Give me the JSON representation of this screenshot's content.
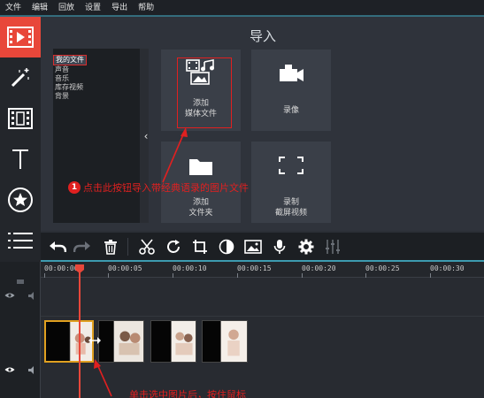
{
  "menu": {
    "items": [
      "文件",
      "编辑",
      "回放",
      "设置",
      "导出",
      "帮助"
    ]
  },
  "rail": {
    "buttons": [
      {
        "name": "import-icon",
        "active": true
      },
      {
        "name": "magic-wand-icon",
        "active": false
      },
      {
        "name": "film-icon",
        "active": false
      },
      {
        "name": "text-icon",
        "active": false
      },
      {
        "name": "sticker-icon",
        "active": false
      },
      {
        "name": "list-icon",
        "active": false
      }
    ]
  },
  "import": {
    "title": "导入",
    "folders": [
      "我的文件",
      "声音",
      "音乐",
      "库存视频",
      "背景"
    ],
    "selected_folder": "我的文件",
    "tiles": {
      "add_media": {
        "line1": "添加",
        "line2": "媒体文件",
        "icon": "add-media-icon"
      },
      "record": {
        "line1": "录像",
        "icon": "camera-icon"
      },
      "add_folder": {
        "line1": "添加",
        "line2": "文件夹",
        "icon": "folder-icon"
      },
      "screen_capture": {
        "line1": "录制",
        "line2": "截屏视频",
        "icon": "screen-capture-icon"
      }
    }
  },
  "annotations": {
    "step_number": "1",
    "step_text": "点击此按钮导入带经典语录的图片文件",
    "bottom_text": "单击选中图片后，按住鼠标"
  },
  "toolbar": {
    "icons": [
      "undo-icon",
      "redo-icon",
      "trash-icon",
      "scissors-icon",
      "rotate-icon",
      "crop-icon",
      "color-icon",
      "image-icon",
      "microphone-icon",
      "gear-icon",
      "equalizer-icon"
    ]
  },
  "timeline": {
    "ticks": [
      "00:00:00",
      "00:00:05",
      "00:00:10",
      "00:00:15",
      "00:00:20",
      "00:00:25",
      "00:00:30"
    ],
    "clips": [
      {
        "name": "clip-1",
        "selected": true
      },
      {
        "name": "clip-2",
        "selected": false
      },
      {
        "name": "clip-3",
        "selected": false
      },
      {
        "name": "clip-4",
        "selected": false
      }
    ]
  },
  "colors": {
    "accent": "#e8473a",
    "teal": "#3d9bb0",
    "annotation": "#e02020"
  }
}
